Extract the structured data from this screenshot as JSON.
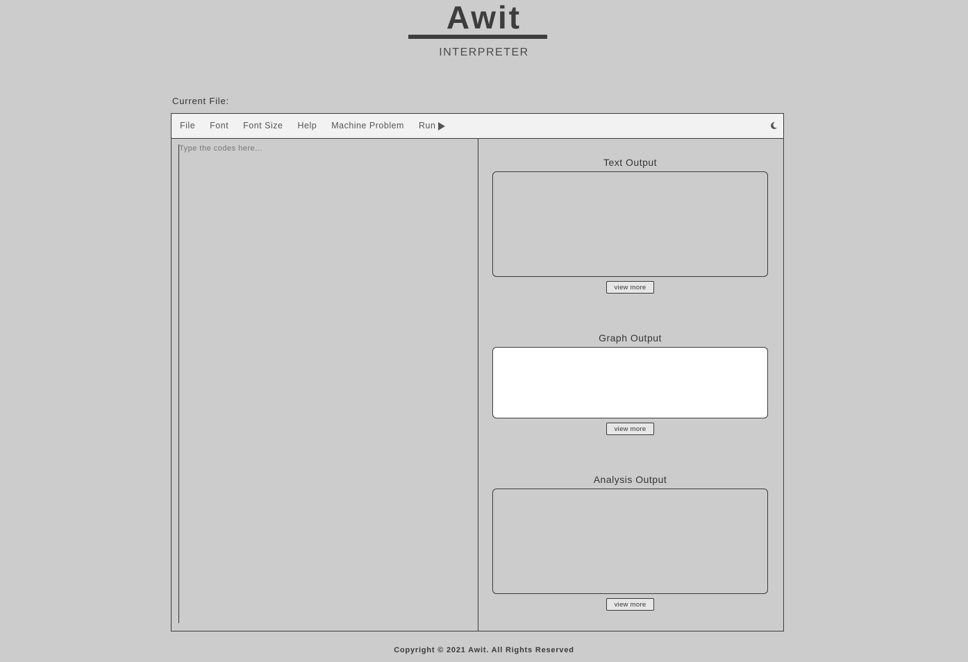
{
  "header": {
    "title": "Awit",
    "subtitle": "INTERPRETER"
  },
  "current_file": {
    "label": "Current File:",
    "name": ""
  },
  "toolbar": {
    "menu": [
      "File",
      "Font",
      "Font Size",
      "Help",
      "Machine Problem"
    ],
    "run_label": "Run",
    "theme_icon": "moon-icon"
  },
  "editor": {
    "placeholder": "Type the codes here...",
    "value": ""
  },
  "outputs": {
    "text": {
      "title": "Text Output",
      "view_more": "view more"
    },
    "graph": {
      "title": "Graph Output",
      "view_more": "view more"
    },
    "analysis": {
      "title": "Analysis Output",
      "view_more": "view more"
    }
  },
  "footer": {
    "text": "Copyright © 2021 Awit. All Rights Reserved"
  },
  "colors": {
    "background": "#cccccc",
    "toolbar": "#f2f2f2",
    "text_dark": "#3d3d3d",
    "graph_box": "#ffffff"
  }
}
